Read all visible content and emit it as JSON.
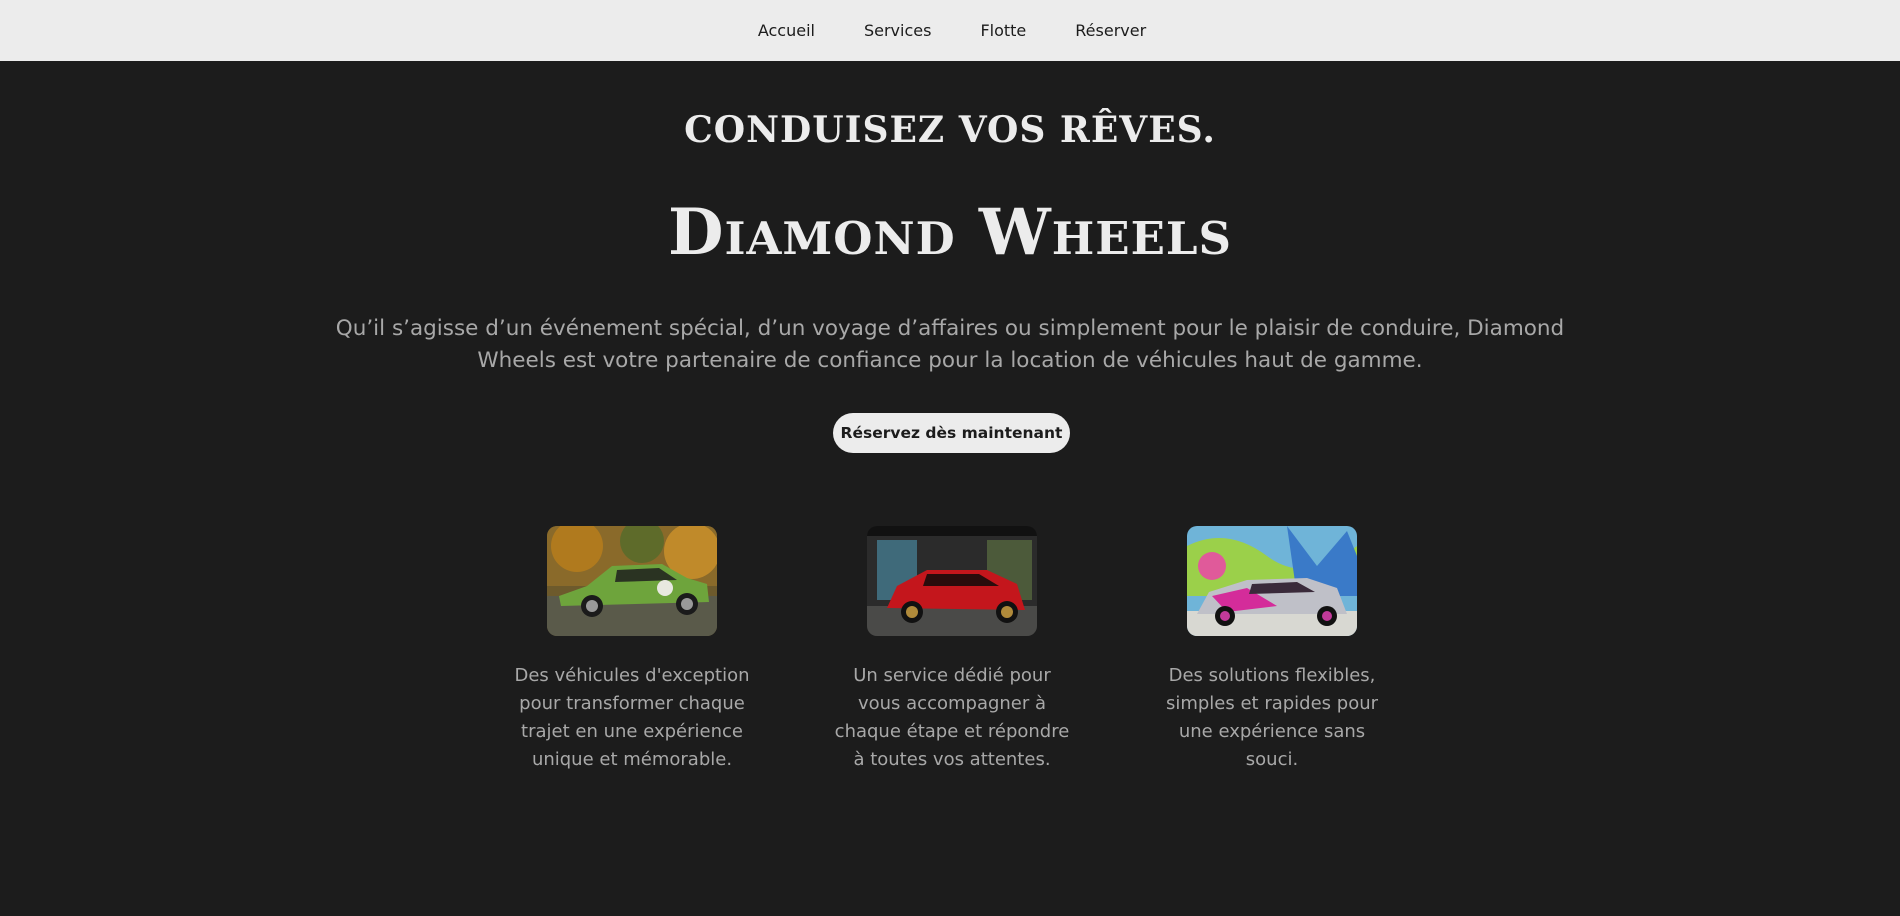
{
  "nav": {
    "items": [
      {
        "label": "Accueil"
      },
      {
        "label": "Services"
      },
      {
        "label": "Flotte"
      },
      {
        "label": "Réserver"
      }
    ]
  },
  "hero": {
    "tagline": "Conduisez vos rêves.",
    "brand": "Diamond Wheels",
    "intro": "Qu’il s’agisse d’un événement spécial, d’un voyage d’affaires ou simplement pour le plaisir de conduire, Diamond Wheels est votre partenaire de confiance pour la location de véhicules haut de gamme.",
    "cta_label": "Réservez dès maintenant"
  },
  "features": [
    {
      "image": "green-car-photo",
      "text": "Des véhicules d'exception pour transformer chaque trajet en une expérience unique et mémorable."
    },
    {
      "image": "red-car-photo",
      "text": "Un service dédié pour vous accompagner à chaque étape et répondre à toutes vos attentes."
    },
    {
      "image": "graffiti-car-photo",
      "text": "Des solutions flexibles, simples et rapides pour une expérience sans souci."
    }
  ],
  "colors": {
    "background": "#1c1c1c",
    "navbar": "#ececec",
    "text_primary": "#ececec",
    "text_secondary": "#a8a8a8"
  }
}
